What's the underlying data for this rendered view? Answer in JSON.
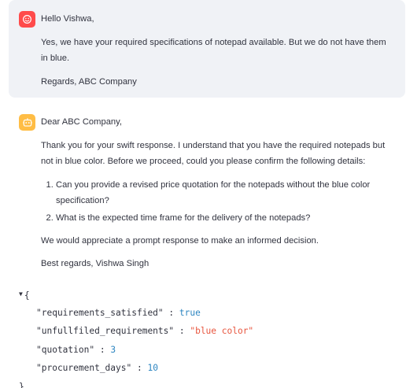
{
  "user_message": {
    "avatar_icon": "user-smiley-icon",
    "avatar_color": "#ff4b4b",
    "greeting": "Hello Vishwa,",
    "body": "Yes, we have your required specifications of notepad available. But we do not have them in blue.",
    "signoff": "Regards, ABC Company"
  },
  "assistant_message": {
    "avatar_icon": "bot-icon",
    "avatar_color": "#ffbd45",
    "greeting": "Dear ABC Company,",
    "intro": "Thank you for your swift response. I understand that you have the required notepads but not in blue color. Before we proceed, could you please confirm the following details:",
    "questions": [
      "Can you provide a revised price quotation for the notepads without the blue color specification?",
      "What is the expected time frame for the delivery of the notepads?"
    ],
    "closing": "We would appreciate a prompt response to make an informed decision.",
    "signoff": "Best regards, Vishwa Singh"
  },
  "json_view": {
    "open_brace": "{",
    "close_brace": "}",
    "entries": [
      {
        "key": "\"requirements_satisfied\"",
        "value": "true"
      },
      {
        "key": "\"unfullfiled_requirements\"",
        "value": "\"blue color\""
      },
      {
        "key": "\"quotation\"",
        "value": "3"
      },
      {
        "key": "\"procurement_days\"",
        "value": "10"
      }
    ],
    "separator": " : ",
    "comma": ","
  }
}
